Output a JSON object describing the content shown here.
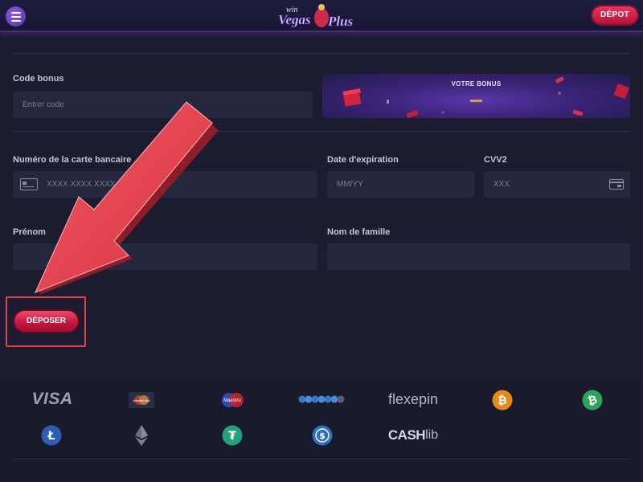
{
  "header": {
    "logo_text_1": "win",
    "logo_text_2": "Vegas",
    "logo_text_3": "Plus",
    "depot_label": "DÉPOT"
  },
  "bonus": {
    "label": "Code bonus",
    "placeholder": "Entrer code",
    "panel_title": "VOTRE BONUS"
  },
  "card": {
    "number_label": "Numéro de la carte bancaire",
    "number_placeholder": "XXXX XXXX XXXX",
    "expiry_label": "Date d'expiration",
    "expiry_placeholder": "MM/YY",
    "cvv_label": "CVV2",
    "cvv_placeholder": "XXX"
  },
  "name": {
    "first_label": "Prénom",
    "last_label": "Nom de famille"
  },
  "actions": {
    "deposit_label": "DÉPOSER"
  },
  "payments": {
    "visa": "VISA",
    "flexepin": "flexepin",
    "cashlib_1": "CASH",
    "cashlib_2": "lib",
    "maestro": "Maestro",
    "mastercard": "MasterCard",
    "bitcoin_symbol": "₿",
    "litecoin_symbol": "Ł",
    "tether_symbol": "₮",
    "usdc_symbol": "$"
  },
  "colors": {
    "accent": "#c6173f",
    "annotation_arrow": "#e0414f",
    "background": "#1b1c30",
    "field": "#25273f"
  }
}
